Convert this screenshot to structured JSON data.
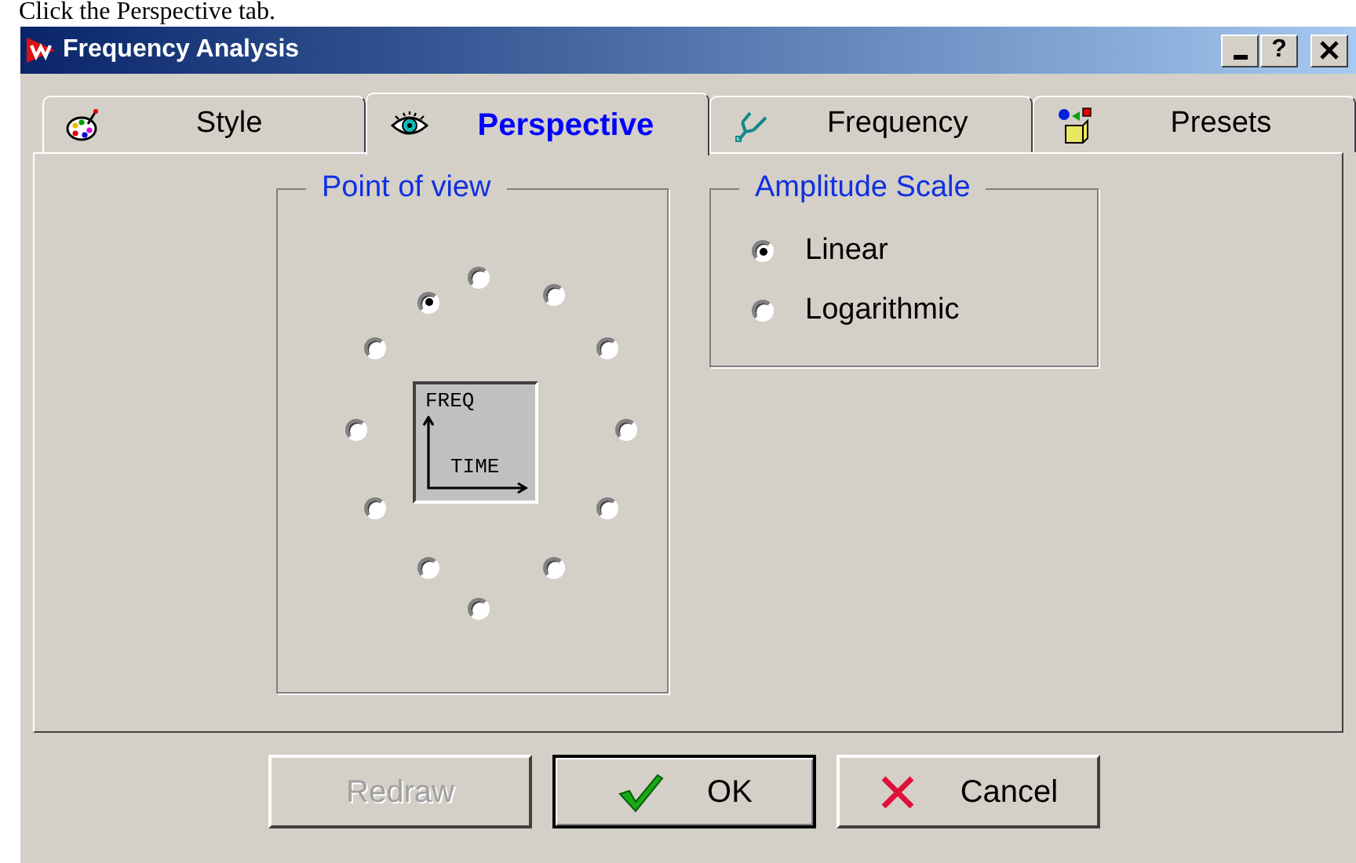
{
  "caption": "Click the Perspective tab.",
  "window": {
    "title": "Frequency Analysis",
    "controls": [
      {
        "kind": "minimize"
      },
      {
        "kind": "help",
        "label": "?"
      },
      {
        "kind": "close"
      }
    ]
  },
  "tabs": [
    {
      "label": "Style",
      "selected": false
    },
    {
      "label": "Perspective",
      "selected": true
    },
    {
      "label": "Frequency",
      "selected": false
    },
    {
      "label": "Presets",
      "selected": false
    }
  ],
  "point_of_view": {
    "title": "Point of view",
    "axis_labels": [
      "FREQ",
      "TIME"
    ],
    "options": [
      {
        "selected": false
      },
      {
        "selected": false
      },
      {
        "selected": false
      },
      {
        "selected": false
      },
      {
        "selected": false
      },
      {
        "selected": false
      },
      {
        "selected": false
      },
      {
        "selected": false
      },
      {
        "selected": false
      },
      {
        "selected": false
      },
      {
        "selected": false
      },
      {
        "selected": true
      }
    ]
  },
  "amplitude_scale": {
    "title": "Amplitude Scale",
    "options": [
      {
        "label": "Linear",
        "selected": true
      },
      {
        "label": "Logarithmic",
        "selected": false
      }
    ]
  },
  "buttons": [
    {
      "label": "Redraw",
      "kind": "plain",
      "disabled": true,
      "default": false
    },
    {
      "label": "OK",
      "kind": "confirm",
      "disabled": false,
      "default": true
    },
    {
      "label": "Cancel",
      "kind": "cancel",
      "disabled": false,
      "default": false
    }
  ]
}
